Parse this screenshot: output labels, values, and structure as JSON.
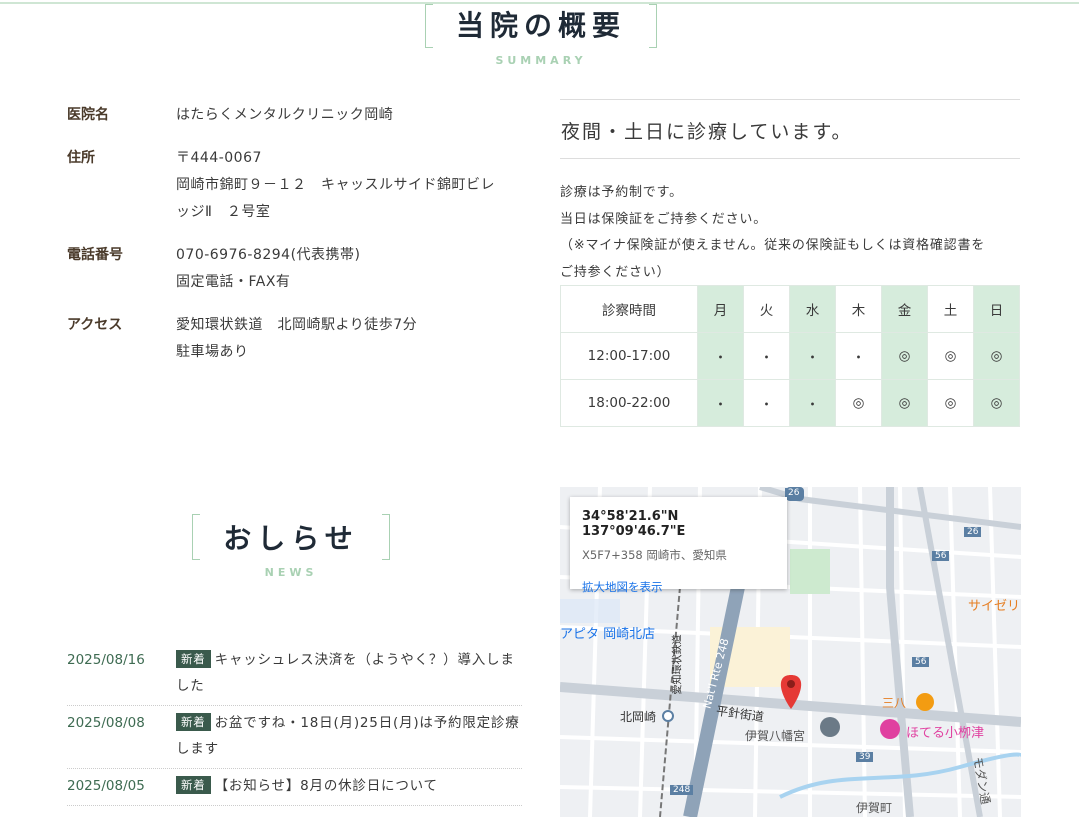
{
  "summary": {
    "title": "当院の概要",
    "subtitle": "SUMMARY"
  },
  "clinic": {
    "name_label": "医院名",
    "name": "はたらくメンタルクリニック岡崎",
    "address_label": "住所",
    "zip": "〒444-0067",
    "address1": "岡崎市錦町９－１２　キャッスルサイド錦町ビレ",
    "address2": "ッジⅡ　２号室",
    "phone_label": "電話番号",
    "phone": "070-6976-8294(代表携帯)",
    "phone_note": "固定電話・FAX有",
    "access_label": "アクセス",
    "access1": "愛知環状鉄道　北岡崎駅より徒歩7分",
    "access2": "駐車場あり"
  },
  "night": {
    "heading": "夜間・土日に診療しています。"
  },
  "notes": {
    "line1": " 診療は予約制です。",
    "line2": "当日は保険証をご持参ください。",
    "line3": "（※マイナ保険証が使えません。従来の保険証もしくは資格確認書を",
    "line4": "ご持参ください）"
  },
  "schedule": {
    "header": [
      "診察時間",
      "月",
      "火",
      "水",
      "木",
      "金",
      "土",
      "日"
    ],
    "rows": [
      [
        "12:00-17:00",
        "・",
        "・",
        "・",
        "・",
        "◎",
        "◎",
        "◎"
      ],
      [
        "18:00-22:00",
        "・",
        "・",
        "・",
        "◎",
        "◎",
        "◎",
        "◎"
      ]
    ]
  },
  "news": {
    "title": "おしらせ",
    "subtitle": "NEWS",
    "items": [
      {
        "date": "2025/08/16",
        "badge": "新着",
        "text": "キャッシュレス決済を（ようやく？）導入しました"
      },
      {
        "date": "2025/08/08",
        "badge": "新着",
        "text": "お盆ですね・18日(月)25日(月)は予約限定診療します"
      },
      {
        "date": "2025/08/05",
        "badge": "新着",
        "text": "【お知らせ】8月の休診日について"
      }
    ]
  },
  "map": {
    "coord": "34°58'21.6\"N 137°09'46.7\"E",
    "plus": "X5F7+358 岡崎市、愛知県",
    "link": "拡大地図を表示",
    "labels": {
      "apita": "アピタ 岡崎北店",
      "kitaokazaki": "北岡崎",
      "hirabari": "平針街道",
      "iga_hachimangu": "伊賀八幡宮",
      "sanpachi": "三八",
      "hoteru": "ほてる小栁津",
      "igamachi": "伊賀町",
      "saize": "サイゼリ",
      "route248": "Nat'l Rte 248",
      "aikan": "愛知環状鉄道",
      "modern": "モダン通",
      "r26a": "26",
      "r26b": "26",
      "r56a": "56",
      "r56b": "56",
      "r39": "39",
      "r248": "248"
    }
  },
  "colors": {
    "accent": "#a9d1b3",
    "highlight": "#d6ecdc",
    "badge": "#3a5a4c",
    "link": "#1a73e8",
    "pin": "#e53935"
  }
}
